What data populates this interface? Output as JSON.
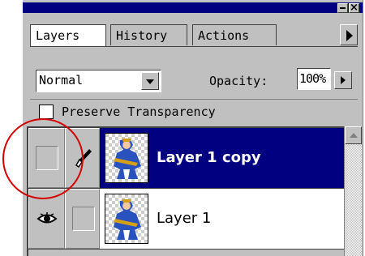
{
  "window": {
    "minimize_icon": "minimize-icon",
    "close_label": "×"
  },
  "tabs": [
    {
      "label": "Layers",
      "active": true
    },
    {
      "label": "History",
      "active": false
    },
    {
      "label": "Actions",
      "active": false
    }
  ],
  "controls": {
    "blend_mode": "Normal",
    "opacity_label": "Opacity:",
    "opacity_value": "100%",
    "preserve_label": "Preserve Transparency",
    "preserve_checked": false
  },
  "layers": [
    {
      "name": "Layer 1 copy",
      "selected": true,
      "visible_eye": false,
      "brush": true
    },
    {
      "name": "Layer 1",
      "selected": false,
      "visible_eye": true,
      "brush": false
    }
  ],
  "annotation": {
    "color": "#d40000",
    "shape": "circle"
  },
  "colors": {
    "panel": "#c0c0c0",
    "selection": "#000080",
    "titlebar": "#000080"
  }
}
